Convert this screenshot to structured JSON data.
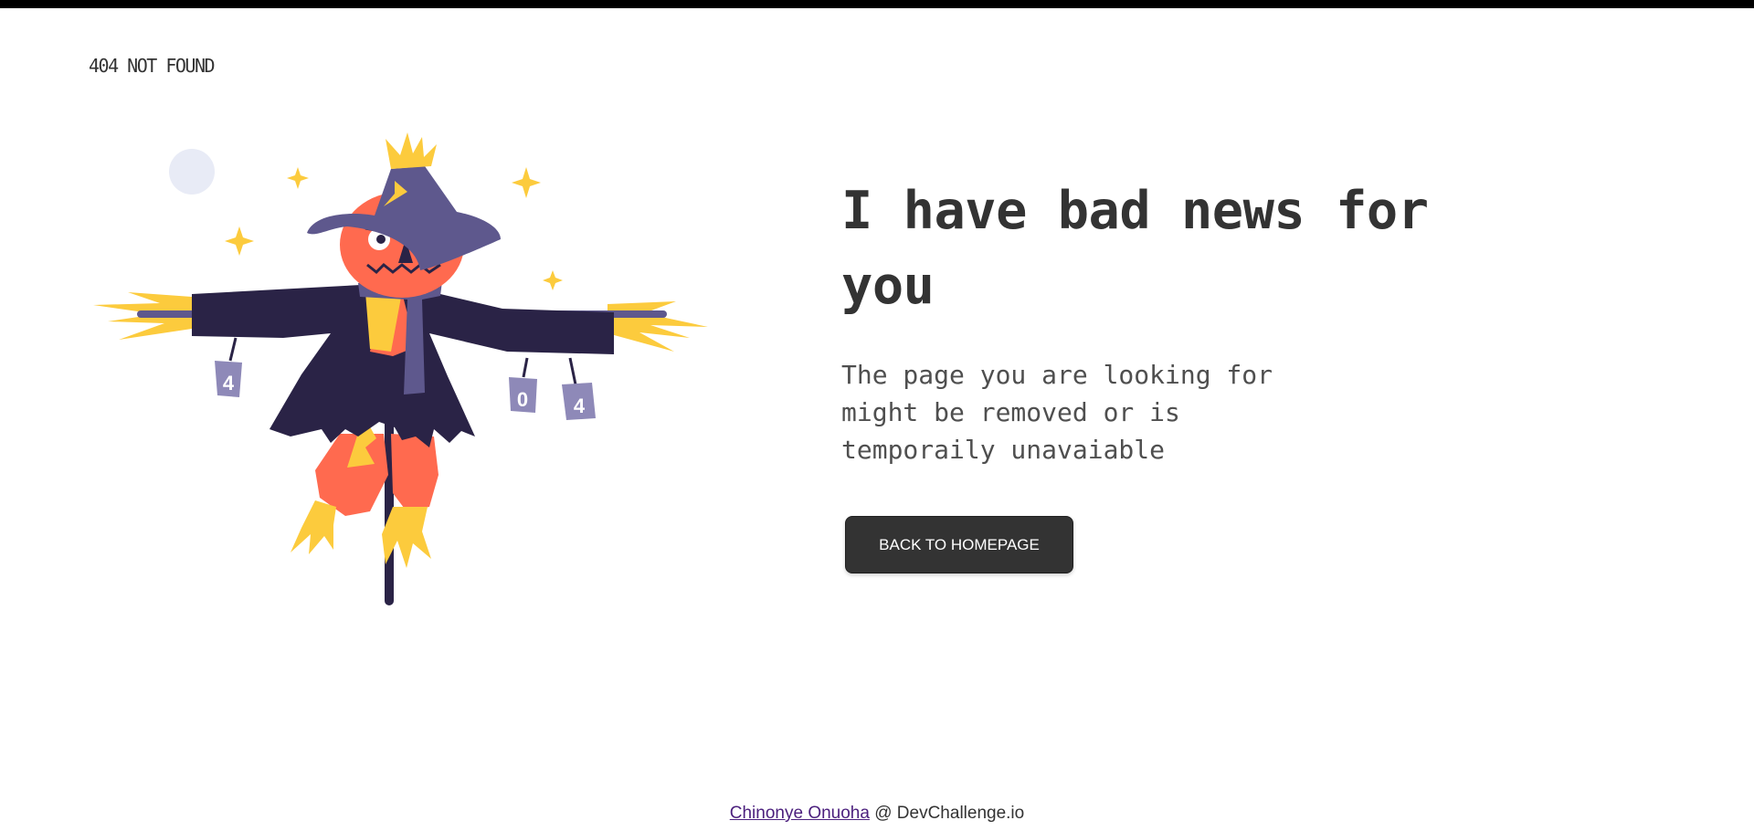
{
  "header": {
    "logo_text": "404 NOT FOUND"
  },
  "main": {
    "headline": "I have bad news for you",
    "subtext": "The page you are looking for might be removed or is temporaily unavaiable",
    "button_label": "BACK TO HOMEPAGE"
  },
  "illustration": {
    "can_labels": [
      "4",
      "0",
      "4"
    ]
  },
  "footer": {
    "author": "Chinonye Onuoha",
    "separator": "@",
    "site": "DevChallenge.io"
  },
  "colors": {
    "text_dark": "#333333",
    "button_bg": "#333333",
    "hat": "#5e588d",
    "coat": "#2a2346",
    "face": "#ff6a4f",
    "straw": "#fccb3d",
    "moon": "#e8ebf6"
  }
}
